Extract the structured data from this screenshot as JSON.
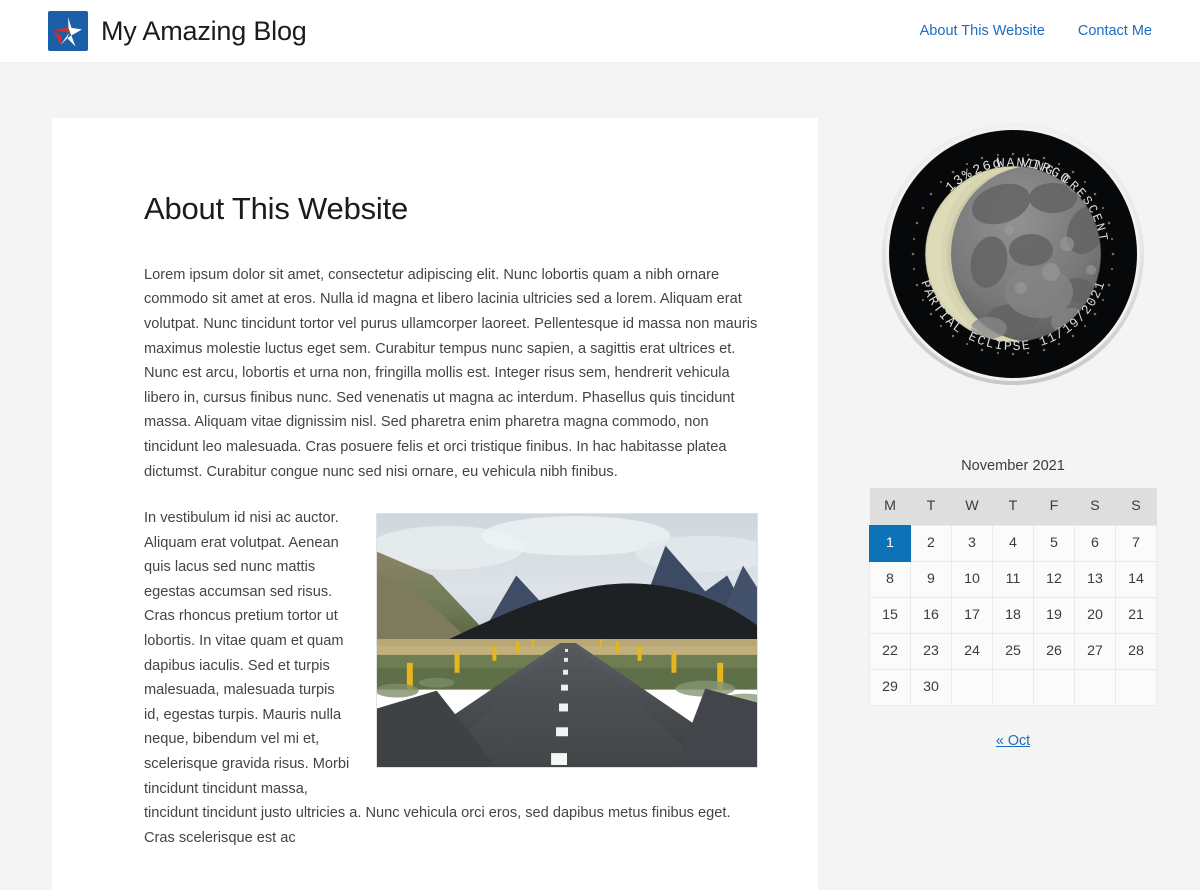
{
  "header": {
    "logo_icon": "star-logo-icon",
    "site_title": "My Amazing Blog",
    "nav": [
      {
        "label": "About This Website"
      },
      {
        "label": "Contact Me"
      }
    ]
  },
  "article": {
    "title": "About This Website",
    "paragraphs": [
      "Lorem ipsum dolor sit amet, consectetur adipiscing elit. Nunc lobortis quam a nibh ornare commodo sit amet at eros. Nulla id magna et libero lacinia ultricies sed a lorem. Aliquam erat volutpat. Nunc tincidunt tortor vel purus ullamcorper laoreet. Pellentesque id massa non mauris maximus molestie luctus eget sem. Curabitur tempus nunc sapien, a sagittis erat ultrices et. Nunc est arcu, lobortis et urna non, fringilla mollis est. Integer risus sem, hendrerit vehicula libero in, cursus finibus nunc. Sed venenatis ut magna ac interdum. Phasellus quis tincidunt massa. Aliquam vitae dignissim nisl. Sed pharetra enim pharetra magna commodo, non tincidunt leo malesuada. Cras posuere felis et orci tristique finibus. In hac habitasse platea dictumst. Curabitur congue nunc sed nisi ornare, eu vehicula nibh finibus.",
      "In vestibulum id nisi ac auctor. Aliquam erat volutpat. Aenean quis lacus sed nunc mattis egestas accumsan sed risus. Cras rhoncus pretium tortor ut lobortis. In vitae quam et quam dapibus iaculis. Sed et turpis malesuada, malesuada turpis id, egestas turpis. Mauris nulla neque, bibendum vel mi et, scelerisque gravida risus. Morbi tincidunt tincidunt massa, tincidunt tincidunt justo ultricies a. Nunc vehicula orci eros, sed dapibus metus finibus eget. Cras scelerisque est ac"
    ],
    "image_alt": "road-through-mountains-photo"
  },
  "sidebar": {
    "moon": {
      "percent": "13%",
      "age": "26d",
      "zodiac": "VIRGO",
      "phase_name": "WANING CRESCENT",
      "event": "PARTIAL ECLIPSE 11/19/2021"
    },
    "calendar": {
      "caption": "November 2021",
      "weekday_headers": [
        "M",
        "T",
        "W",
        "T",
        "F",
        "S",
        "S"
      ],
      "weeks": [
        [
          "1",
          "2",
          "3",
          "4",
          "5",
          "6",
          "7"
        ],
        [
          "8",
          "9",
          "10",
          "11",
          "12",
          "13",
          "14"
        ],
        [
          "15",
          "16",
          "17",
          "18",
          "19",
          "20",
          "21"
        ],
        [
          "22",
          "23",
          "24",
          "25",
          "26",
          "27",
          "28"
        ],
        [
          "29",
          "30",
          "",
          "",
          "",
          "",
          ""
        ]
      ],
      "today": "1",
      "prev_link": "« Oct"
    }
  },
  "colors": {
    "page_background": "#f4f4f4",
    "card_background": "#ffffff",
    "link": "#1b6dc1",
    "today_highlight": "#0d72b8",
    "calendar_header": "#dedede",
    "logo_blue": "#1b5fa8",
    "logo_red": "#d62b2b"
  }
}
